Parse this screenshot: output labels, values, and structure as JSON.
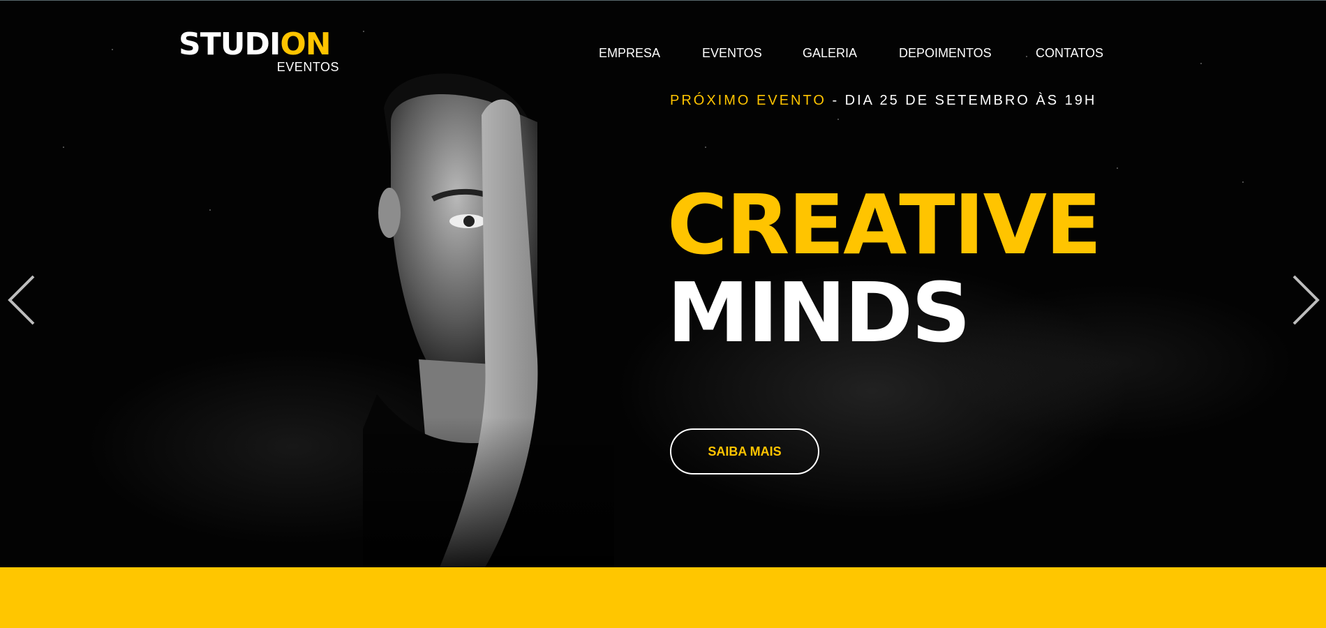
{
  "brand": {
    "logo_white": "STUDI",
    "logo_yellow": "ON",
    "logo_sub": "EVENTOS"
  },
  "nav": {
    "items": [
      {
        "label": "EMPRESA"
      },
      {
        "label": "EVENTOS"
      },
      {
        "label": "GALERIA"
      },
      {
        "label": "DEPOIMENTOS"
      },
      {
        "label": "CONTATOS"
      }
    ]
  },
  "hero": {
    "next_event_label": "PRÓXIMO EVENTO",
    "next_event_detail": " - DIA 25 DE SETEMBRO ÀS 19H",
    "headline_line1": "CREATIVE",
    "headline_line2": "MINDS",
    "cta_label": "SAIBA MAIS"
  },
  "slider": {
    "prev_icon": "chevron-left-icon",
    "next_icon": "chevron-right-icon"
  },
  "colors": {
    "accent": "#ffc400",
    "background": "#030303",
    "band": "#ffc600",
    "text": "#ffffff"
  }
}
